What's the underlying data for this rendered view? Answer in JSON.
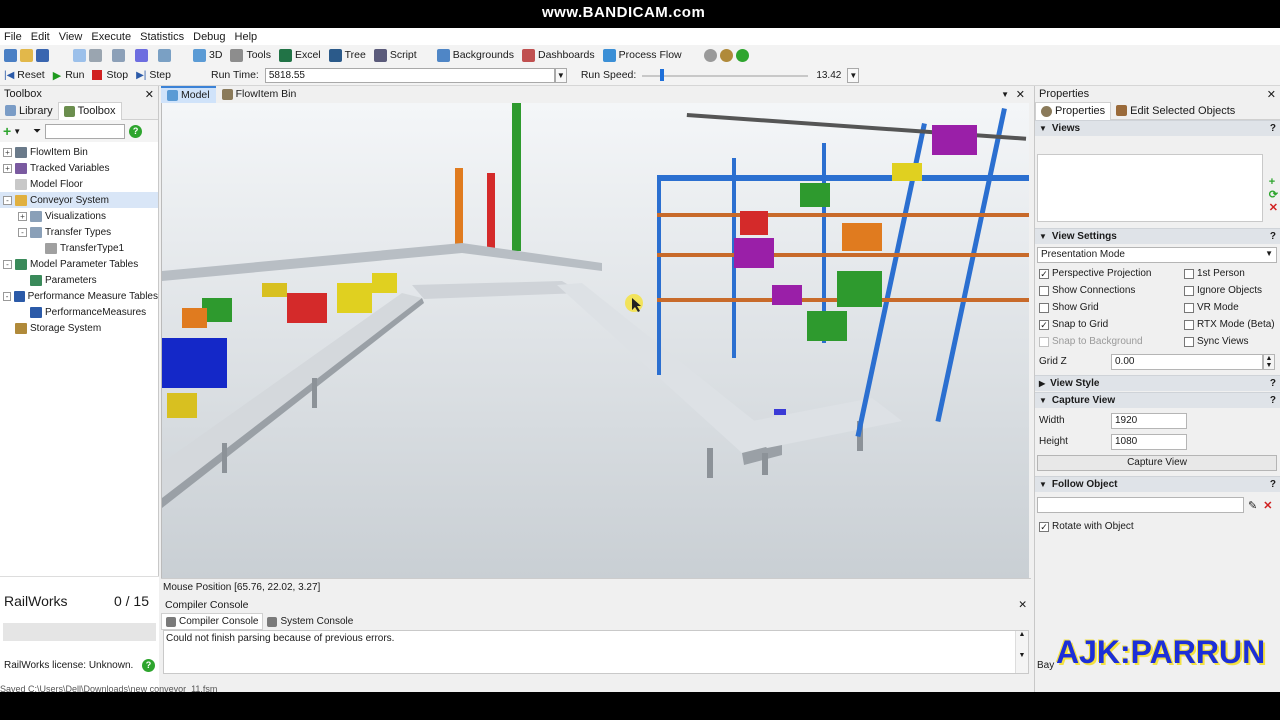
{
  "watermark_top": "www.BANDICAM.com",
  "watermark_bottom": "AJK:PARRUN",
  "menu": [
    "File",
    "Edit",
    "View",
    "Execute",
    "Statistics",
    "Debug",
    "Help"
  ],
  "toolbar": {
    "d3": "3D",
    "tools": "Tools",
    "excel": "Excel",
    "tree": "Tree",
    "script": "Script",
    "backgrounds": "Backgrounds",
    "dashboards": "Dashboards",
    "process_flow": "Process Flow"
  },
  "run_controls": {
    "reset": "Reset",
    "run": "Run",
    "stop": "Stop",
    "step": "Step",
    "run_time_label": "Run Time:",
    "run_time_value": "5818.55",
    "run_speed_label": "Run Speed:",
    "run_speed_value": "13.42",
    "speed_slider_fraction": 0.11
  },
  "toolbox": {
    "title": "Toolbox",
    "tabs": [
      "Library",
      "Toolbox"
    ],
    "items": [
      {
        "label": "FlowItem Bin",
        "level": 0,
        "expander": "+"
      },
      {
        "label": "Tracked Variables",
        "level": 0,
        "expander": "+"
      },
      {
        "label": "Model Floor",
        "level": 0,
        "expander": ""
      },
      {
        "label": "Conveyor System",
        "level": 0,
        "expander": "-"
      },
      {
        "label": "Visualizations",
        "level": 1,
        "expander": "+"
      },
      {
        "label": "Transfer Types",
        "level": 1,
        "expander": "-"
      },
      {
        "label": "TransferType1",
        "level": 2,
        "expander": ""
      },
      {
        "label": "Model Parameter Tables",
        "level": 0,
        "expander": "-"
      },
      {
        "label": "Parameters",
        "level": 1,
        "expander": ""
      },
      {
        "label": "Performance Measure Tables",
        "level": 0,
        "expander": "-"
      },
      {
        "label": "PerformanceMeasures",
        "level": 1,
        "expander": ""
      },
      {
        "label": "Storage System",
        "level": 0,
        "expander": ""
      }
    ],
    "railworks_title": "RailWorks",
    "railworks_count": "0 / 15",
    "railworks_license": "RailWorks license: Unknown."
  },
  "doc_tabs": [
    "Model",
    "FlowItem Bin"
  ],
  "mouse_position": "Mouse Position [65.76, 22.02, 3.27]",
  "console": {
    "title": "Compiler Console",
    "tabs": [
      "Compiler Console",
      "System Console"
    ],
    "message": "Could not finish parsing because of previous errors."
  },
  "status_saved": "Saved C:\\Users\\Dell\\Downloads\\new conveyor_11.fsm",
  "properties": {
    "title": "Properties",
    "tabs": [
      "Properties",
      "Edit Selected Objects"
    ],
    "views_header": "Views",
    "view_settings_header": "View Settings",
    "presentation_mode": "Presentation Mode",
    "checkboxes": [
      {
        "label": "Perspective Projection",
        "checked": true,
        "disabled": false
      },
      {
        "label": "1st Person",
        "checked": false,
        "disabled": false
      },
      {
        "label": "Show Connections",
        "checked": false,
        "disabled": false
      },
      {
        "label": "Ignore Objects",
        "checked": false,
        "disabled": false
      },
      {
        "label": "Show Grid",
        "checked": false,
        "disabled": false
      },
      {
        "label": "VR Mode",
        "checked": false,
        "disabled": false
      },
      {
        "label": "Snap to Grid",
        "checked": true,
        "disabled": false
      },
      {
        "label": "RTX Mode (Beta)",
        "checked": false,
        "disabled": false
      },
      {
        "label": "Snap to Background",
        "checked": false,
        "disabled": true
      },
      {
        "label": "Sync Views",
        "checked": false,
        "disabled": false
      }
    ],
    "grid_z_label": "Grid Z",
    "grid_z_value": "0.00",
    "view_style_header": "View Style",
    "capture_view_header": "Capture View",
    "width_label": "Width",
    "width_value": "1920",
    "height_label": "Height",
    "height_value": "1080",
    "capture_button": "Capture View",
    "follow_object_header": "Follow Object",
    "rotate_with_object": "Rotate with Object",
    "bay_label": "Bay"
  }
}
